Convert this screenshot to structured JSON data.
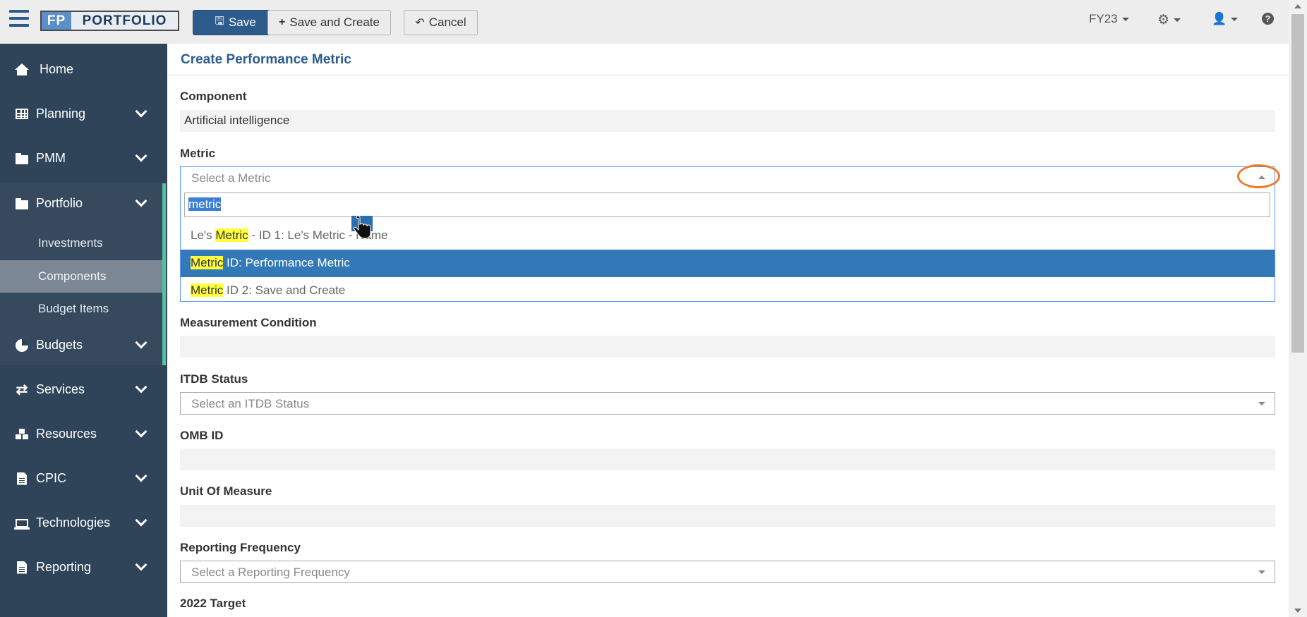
{
  "topbar": {
    "logo_fp": "FP",
    "logo_text": "PORTFOLIO",
    "save_label": "Save",
    "save_create_label": "Save and Create",
    "cancel_label": "Cancel",
    "fiscal_year": "FY23",
    "icons": [
      "hamburger-icon",
      "save-icon",
      "plus-icon",
      "undo-icon",
      "gears-icon",
      "user-icon",
      "help-icon"
    ]
  },
  "sidebar": {
    "items": [
      {
        "label": "Home",
        "icon": "home-icon"
      },
      {
        "label": "Planning",
        "icon": "table-icon"
      },
      {
        "label": "PMM",
        "icon": "folder-icon"
      },
      {
        "label": "Portfolio",
        "icon": "folder-icon"
      },
      {
        "label": "Budgets",
        "icon": "pie-chart-icon"
      },
      {
        "label": "Services",
        "icon": "exchange-icon"
      },
      {
        "label": "Resources",
        "icon": "cubes-icon"
      },
      {
        "label": "CPIC",
        "icon": "document-icon"
      },
      {
        "label": "Technologies",
        "icon": "laptop-icon"
      },
      {
        "label": "Reporting",
        "icon": "document-icon"
      }
    ],
    "portfolio_sub": [
      {
        "label": "Investments"
      },
      {
        "label": "Components",
        "active": true
      },
      {
        "label": "Budget Items"
      }
    ]
  },
  "main": {
    "title": "Create Performance Metric",
    "component_label": "Component",
    "component_value": "Artificial intelligence",
    "metric_label": "Metric",
    "metric_placeholder": "Select a Metric",
    "metric_search": "metric",
    "metric_options": [
      {
        "match": "Metric",
        "pre": "Le's ",
        "post": " - ID 1: Le's Metric - Name"
      },
      {
        "match": "Metric",
        "pre": "",
        "post": " ID: Performance Metric"
      },
      {
        "match": "Metric",
        "pre": "",
        "post": " ID 2: Save and Create"
      }
    ],
    "measurement_condition_label": "Measurement Condition",
    "itdb_status_label": "ITDB Status",
    "itdb_status_placeholder": "Select an ITDB Status",
    "omb_id_label": "OMB ID",
    "unit_of_measure_label": "Unit Of Measure",
    "reporting_frequency_label": "Reporting Frequency",
    "reporting_frequency_placeholder": "Select a Reporting Frequency",
    "target_label": "2022 Target"
  },
  "colors": {
    "sidebar_bg": "#2f4459",
    "accent": "#2c5b8c",
    "portfolio_accent": "#4fc3a1",
    "highlight": "#ffff3c",
    "active_option": "#3379b7",
    "annotation_ring": "#f07a2a"
  }
}
